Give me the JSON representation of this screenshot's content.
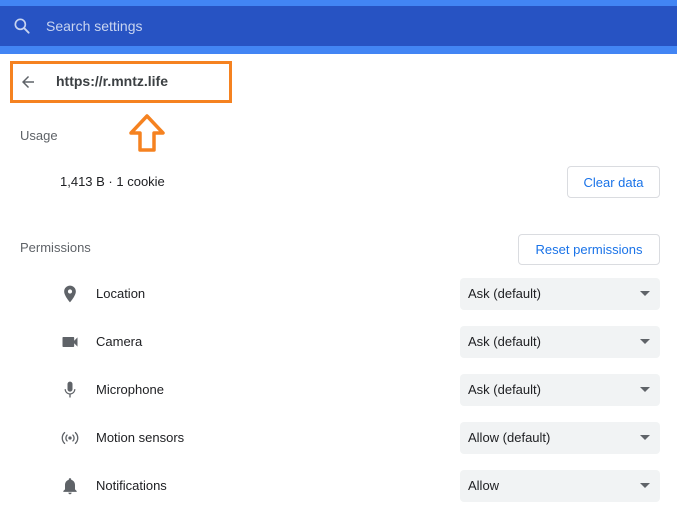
{
  "search": {
    "placeholder": "Search settings"
  },
  "site": {
    "url": "https://r.mntz.life"
  },
  "usage": {
    "heading": "Usage",
    "summary": "1,413 B · 1 cookie",
    "clear_label": "Clear data"
  },
  "permissions": {
    "heading": "Permissions",
    "reset_label": "Reset permissions",
    "items": [
      {
        "label": "Location",
        "value": "Ask (default)",
        "icon": "location-pin-icon"
      },
      {
        "label": "Camera",
        "value": "Ask (default)",
        "icon": "camera-icon"
      },
      {
        "label": "Microphone",
        "value": "Ask (default)",
        "icon": "microphone-icon"
      },
      {
        "label": "Motion sensors",
        "value": "Allow (default)",
        "icon": "motion-sensors-icon"
      },
      {
        "label": "Notifications",
        "value": "Allow",
        "icon": "bell-icon"
      }
    ]
  },
  "colors": {
    "header": "#3367d6",
    "accent": "#1a73e8",
    "annotation": "#f58220"
  }
}
